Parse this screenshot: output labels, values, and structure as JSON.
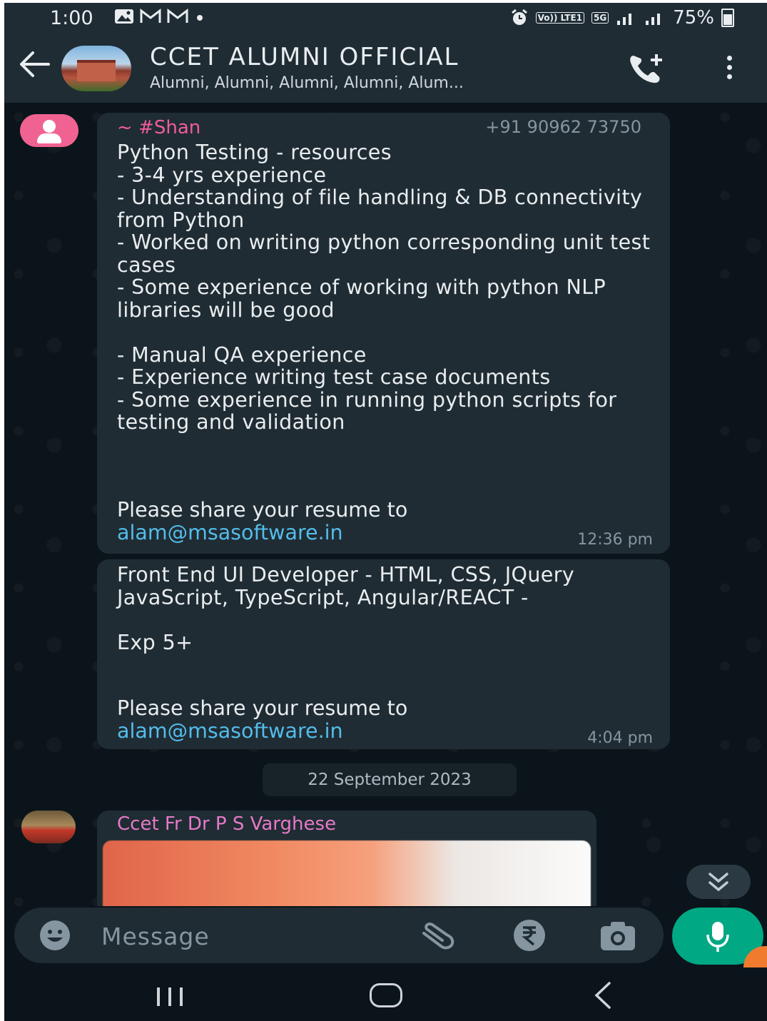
{
  "status_bar": {
    "time": "1:00",
    "left_icons": [
      "gallery-icon",
      "gmail-icon",
      "gmail-icon",
      "dot-icon"
    ],
    "volte_label": "Vo)) LTE1",
    "network_label": "5G",
    "battery": "75%"
  },
  "header": {
    "back_icon": "arrow-left-icon",
    "title": "CCET ALUMNI OFFICIAL",
    "subtitle": "Alumni, Alumni, Alumni, Alumni, Alum...",
    "call_icon": "add-call-icon",
    "menu_icon": "more-vert-icon"
  },
  "messages": [
    {
      "sender": "~ #Shan",
      "phone": "+91 90962 73750",
      "body": "Python Testing - resources\n- 3-4 yrs experience\n- Understanding of file handling & DB connectivity from Python\n- Worked on writing python corresponding unit test cases\n- Some experience of working with python NLP libraries will be good\n\n- Manual QA experience\n- Experience writing test case documents\n- Some experience in running python scripts for testing and validation",
      "share": "Please share your resume to",
      "email": "alam@msasoftware.in",
      "time": "12:36 pm"
    },
    {
      "body": "Front End UI Developer - HTML, CSS, JQuery JavaScript, TypeScript, Angular/REACT -\n\nExp 5+",
      "share": "Please share your resume to",
      "email": "alam@msasoftware.in",
      "time": "4:04 pm"
    }
  ],
  "date_chip": "22 September 2023",
  "next_message": {
    "sender": "Ccet Fr Dr P S Varghese"
  },
  "input": {
    "placeholder": "Message"
  },
  "colors": {
    "accent": "#00a884",
    "sender_shan": "#f15c9c",
    "sender_varghese": "#e57ac8",
    "link": "#53bdeb"
  }
}
